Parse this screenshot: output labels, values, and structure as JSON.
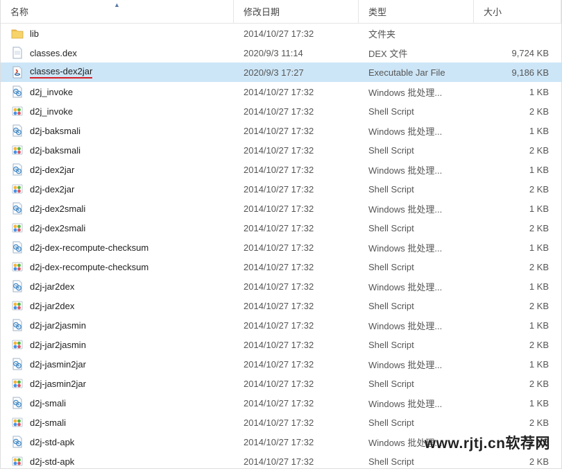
{
  "header": {
    "name": "名称",
    "date": "修改日期",
    "type": "类型",
    "size": "大小"
  },
  "watermark": "www.rjtj.cn软荐网",
  "rows": [
    {
      "icon": "folder",
      "name": "lib",
      "date": "2014/10/27 17:32",
      "type": "文件夹",
      "size": ""
    },
    {
      "icon": "file",
      "name": "classes.dex",
      "date": "2020/9/3 11:14",
      "type": "DEX 文件",
      "size": "9,724 KB"
    },
    {
      "icon": "jar",
      "name": "classes-dex2jar",
      "date": "2020/9/3 17:27",
      "type": "Executable Jar File",
      "size": "9,186 KB",
      "selected": true,
      "underline": true
    },
    {
      "icon": "bat",
      "name": "d2j_invoke",
      "date": "2014/10/27 17:32",
      "type": "Windows 批处理...",
      "size": "1 KB"
    },
    {
      "icon": "sh",
      "name": "d2j_invoke",
      "date": "2014/10/27 17:32",
      "type": "Shell Script",
      "size": "2 KB"
    },
    {
      "icon": "bat",
      "name": "d2j-baksmali",
      "date": "2014/10/27 17:32",
      "type": "Windows 批处理...",
      "size": "1 KB"
    },
    {
      "icon": "sh",
      "name": "d2j-baksmali",
      "date": "2014/10/27 17:32",
      "type": "Shell Script",
      "size": "2 KB"
    },
    {
      "icon": "bat",
      "name": "d2j-dex2jar",
      "date": "2014/10/27 17:32",
      "type": "Windows 批处理...",
      "size": "1 KB"
    },
    {
      "icon": "sh",
      "name": "d2j-dex2jar",
      "date": "2014/10/27 17:32",
      "type": "Shell Script",
      "size": "2 KB"
    },
    {
      "icon": "bat",
      "name": "d2j-dex2smali",
      "date": "2014/10/27 17:32",
      "type": "Windows 批处理...",
      "size": "1 KB"
    },
    {
      "icon": "sh",
      "name": "d2j-dex2smali",
      "date": "2014/10/27 17:32",
      "type": "Shell Script",
      "size": "2 KB"
    },
    {
      "icon": "bat",
      "name": "d2j-dex-recompute-checksum",
      "date": "2014/10/27 17:32",
      "type": "Windows 批处理...",
      "size": "1 KB"
    },
    {
      "icon": "sh",
      "name": "d2j-dex-recompute-checksum",
      "date": "2014/10/27 17:32",
      "type": "Shell Script",
      "size": "2 KB"
    },
    {
      "icon": "bat",
      "name": "d2j-jar2dex",
      "date": "2014/10/27 17:32",
      "type": "Windows 批处理...",
      "size": "1 KB"
    },
    {
      "icon": "sh",
      "name": "d2j-jar2dex",
      "date": "2014/10/27 17:32",
      "type": "Shell Script",
      "size": "2 KB"
    },
    {
      "icon": "bat",
      "name": "d2j-jar2jasmin",
      "date": "2014/10/27 17:32",
      "type": "Windows 批处理...",
      "size": "1 KB"
    },
    {
      "icon": "sh",
      "name": "d2j-jar2jasmin",
      "date": "2014/10/27 17:32",
      "type": "Shell Script",
      "size": "2 KB"
    },
    {
      "icon": "bat",
      "name": "d2j-jasmin2jar",
      "date": "2014/10/27 17:32",
      "type": "Windows 批处理...",
      "size": "1 KB"
    },
    {
      "icon": "sh",
      "name": "d2j-jasmin2jar",
      "date": "2014/10/27 17:32",
      "type": "Shell Script",
      "size": "2 KB"
    },
    {
      "icon": "bat",
      "name": "d2j-smali",
      "date": "2014/10/27 17:32",
      "type": "Windows 批处理...",
      "size": "1 KB"
    },
    {
      "icon": "sh",
      "name": "d2j-smali",
      "date": "2014/10/27 17:32",
      "type": "Shell Script",
      "size": "2 KB"
    },
    {
      "icon": "bat",
      "name": "d2j-std-apk",
      "date": "2014/10/27 17:32",
      "type": "Windows 批处理...",
      "size": "1 KB"
    },
    {
      "icon": "sh",
      "name": "d2j-std-apk",
      "date": "2014/10/27 17:32",
      "type": "Shell Script",
      "size": "2 KB"
    }
  ]
}
